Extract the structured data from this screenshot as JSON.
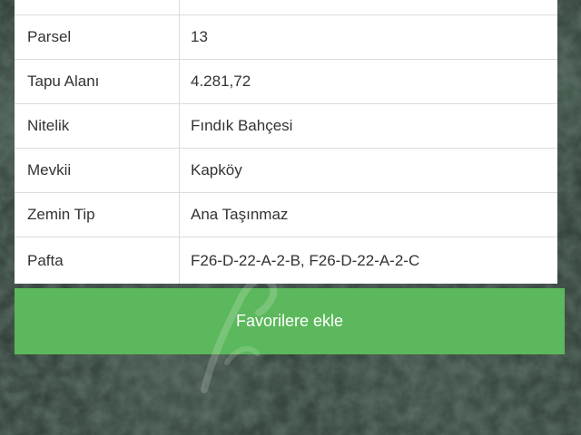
{
  "rows": [
    {
      "label": "",
      "value": ""
    },
    {
      "label": "Parsel",
      "value": "13"
    },
    {
      "label": "Tapu Alanı",
      "value": "4.281,72"
    },
    {
      "label": "Nitelik",
      "value": "Fındık Bahçesi"
    },
    {
      "label": "Mevkii",
      "value": "Kapköy"
    },
    {
      "label": "Zemin Tip",
      "value": "Ana Taşınmaz"
    },
    {
      "label": "Pafta",
      "value": "F26-D-22-A-2-B, F26-D-22-A-2-C"
    }
  ],
  "favorite_button": {
    "label": "Favorilere ekle",
    "color": "#5cb85c"
  },
  "background": {
    "kind": "satellite-map-imagery"
  }
}
